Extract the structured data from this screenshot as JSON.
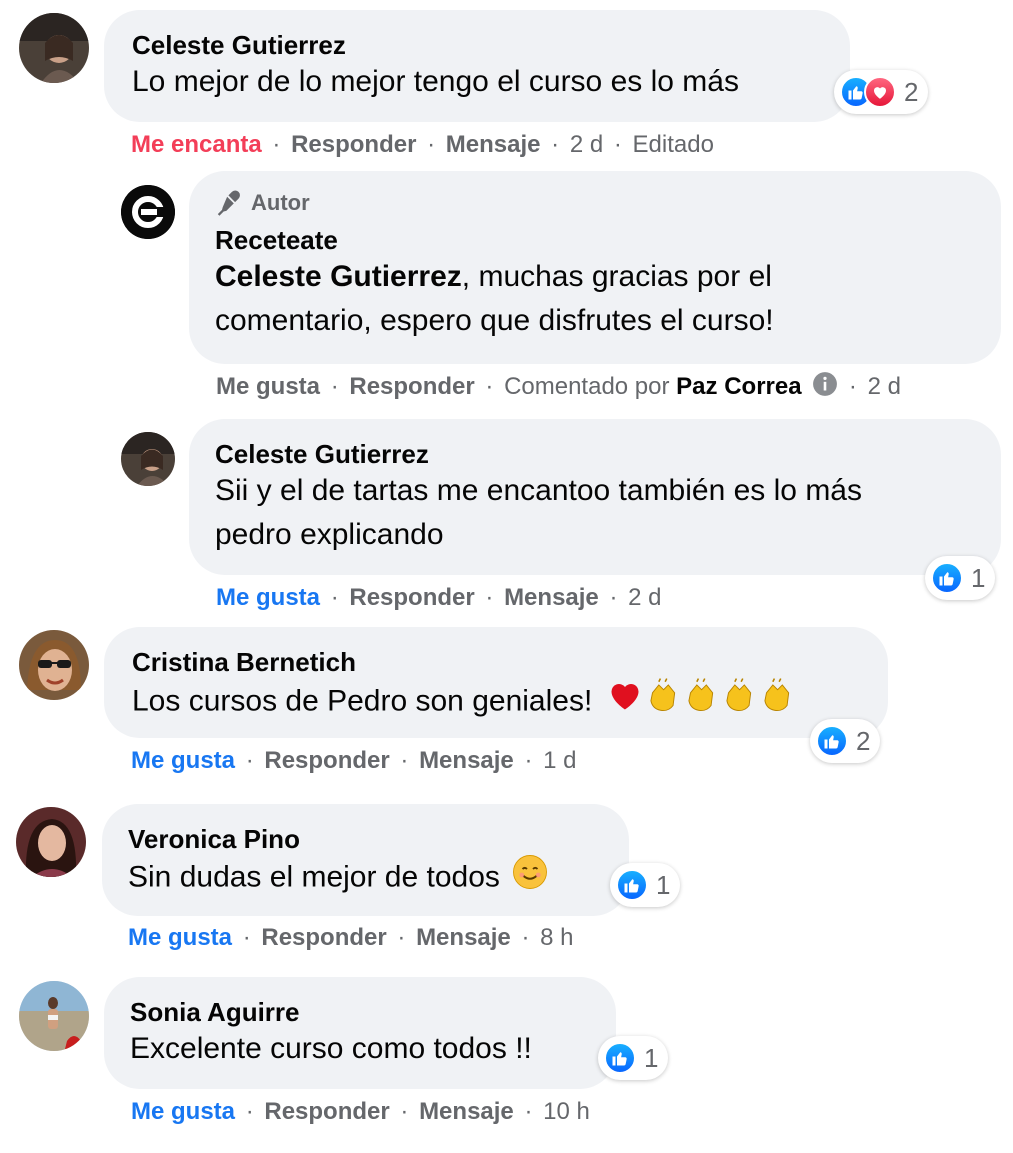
{
  "comments": [
    {
      "author": "Celeste Gutierrez",
      "text": "Lo mejor de lo mejor tengo el curso es lo más",
      "reaction_count": "2",
      "actions": {
        "react": "Me encanta",
        "reply": "Responder",
        "message": "Mensaje",
        "time": "2 d",
        "edited": "Editado"
      }
    },
    {
      "badge": "Autor",
      "author": "Receteate",
      "mention": "Celeste Gutierrez",
      "text_line1": ", muchas gracias por el",
      "text_line2": "comentario, espero que disfrutes el curso!",
      "actions": {
        "react": "Me gusta",
        "reply": "Responder",
        "commented_by_label": "Comentado por",
        "commented_by": "Paz Correa",
        "time": "2 d"
      }
    },
    {
      "author": "Celeste Gutierrez",
      "text_line1": "Sii y el de tartas me encantoo también es lo más",
      "text_line2": "pedro explicando",
      "reaction_count": "1",
      "actions": {
        "react": "Me gusta",
        "reply": "Responder",
        "message": "Mensaje",
        "time": "2 d"
      }
    },
    {
      "author": "Cristina Bernetich",
      "text": "Los cursos de Pedro son geniales!",
      "reaction_count": "2",
      "actions": {
        "react": "Me gusta",
        "reply": "Responder",
        "message": "Mensaje",
        "time": "1 d"
      }
    },
    {
      "author": "Veronica Pino",
      "text": "Sin dudas el mejor de todos",
      "reaction_count": "1",
      "actions": {
        "react": "Me gusta",
        "reply": "Responder",
        "message": "Mensaje",
        "time": "8 h"
      }
    },
    {
      "author": "Sonia Aguirre",
      "text": "Excelente curso como todos !!",
      "reaction_count": "1",
      "actions": {
        "react": "Me gusta",
        "reply": "Responder",
        "message": "Mensaje",
        "time": "10 h"
      }
    }
  ],
  "separator": "·",
  "colors": {
    "like_blue": "#1877f2",
    "love_red": "#f33e58",
    "bubble_bg": "#f0f2f5",
    "muted": "#65676b"
  }
}
